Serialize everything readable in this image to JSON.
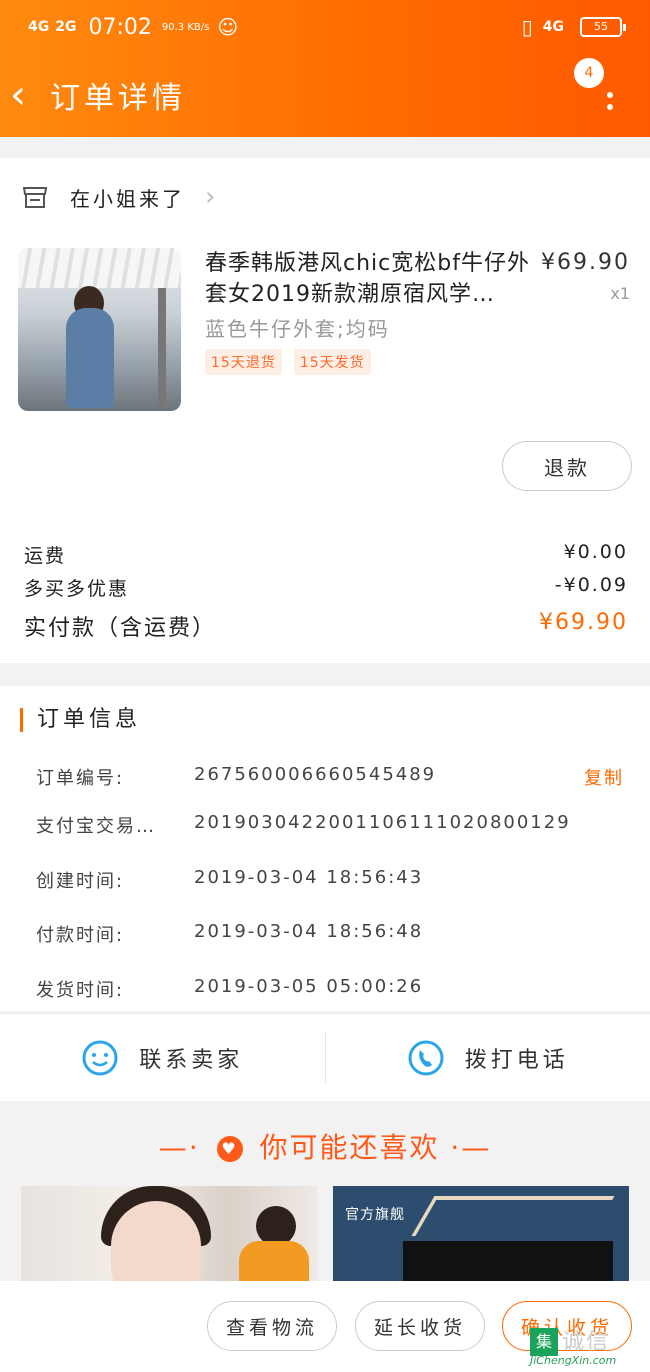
{
  "status_bar": {
    "network1": "4G",
    "network2": "2G",
    "time": "07:02",
    "speed": "90.3 KB/s",
    "network3": "4G",
    "battery": "55"
  },
  "nav": {
    "back_label": "‹",
    "title": "订单详情",
    "badge_count": "4"
  },
  "shop": {
    "name": "在小姐来了",
    "chevron": "›"
  },
  "product": {
    "title": "春季韩版港风chic宽松bf牛仔外套女2019新款潮原宿风学…",
    "price": "¥69.90",
    "qty": "x1",
    "spec": "蓝色牛仔外套;均码",
    "tags": [
      "15天退货",
      "15天发货"
    ],
    "refund_label": "退款"
  },
  "fees": {
    "shipping_label": "运费",
    "shipping_value": "¥0.00",
    "discount_label": "多买多优惠",
    "discount_value": "-¥0.09",
    "total_label": "实付款（含运费）",
    "total_value": "¥69.90"
  },
  "order_info": {
    "title": "订单信息",
    "rows": [
      {
        "label": "订单编号:",
        "value": "267560006660545489"
      },
      {
        "label": "支付宝交易…",
        "value": "2019030422001106111020800129"
      },
      {
        "label": "创建时间:",
        "value": "2019-03-04 18:56:43"
      },
      {
        "label": "付款时间:",
        "value": "2019-03-04 18:56:48"
      },
      {
        "label": "发货时间:",
        "value": "2019-03-05 05:00:26"
      }
    ],
    "copy_label": "复制"
  },
  "contact": {
    "seller_label": "联系卖家",
    "phone_label": "拨打电话"
  },
  "recommend": {
    "title": "你可能还喜欢",
    "dash": "—·",
    "dash2": "·—",
    "store_flag": "官方旗舰"
  },
  "bottom_bar": {
    "logistics": "查看物流",
    "extend": "延长收货",
    "confirm": "确认收货"
  },
  "watermark": {
    "mark": "集",
    "text": "诚信",
    "url": "JiChengXin.com"
  },
  "colors": {
    "accent": "#ff6a00",
    "link_blue": "#2aa6e8"
  }
}
